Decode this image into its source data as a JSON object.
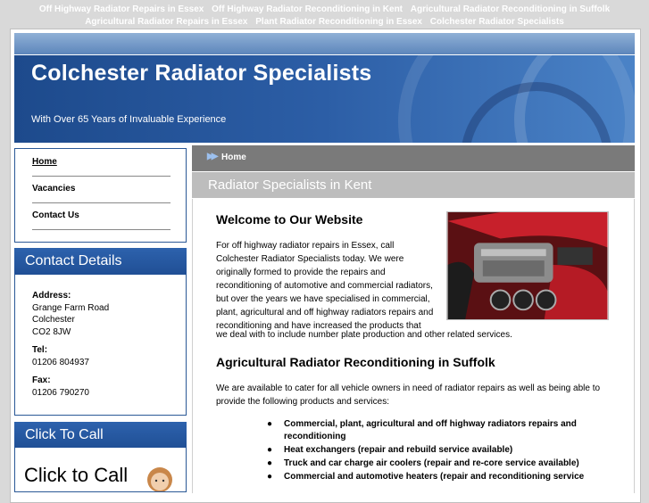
{
  "top_links": [
    "Off Highway Radiator Repairs in Essex",
    "Off Highway Radiator Reconditioning in Kent",
    "Agricultural Radiator Reconditioning in Suffolk",
    "Agricultural Radiator Repairs in Essex",
    "Plant Radiator Reconditioning in Essex",
    "Colchester Radiator Specialists"
  ],
  "header": {
    "title": "Colchester Radiator Specialists",
    "tagline": "With Over 65 Years of Invaluable Experience"
  },
  "nav": {
    "items": [
      {
        "label": "Home",
        "active": true
      },
      {
        "label": "Vacancies",
        "active": false
      },
      {
        "label": "Contact Us",
        "active": false
      }
    ]
  },
  "contact": {
    "heading": "Contact Details",
    "address_label": "Address:",
    "address_lines": [
      "Grange Farm Road",
      "Colchester",
      "CO2 8JW"
    ],
    "tel_label": "Tel:",
    "tel": "01206 804937",
    "fax_label": "Fax:",
    "fax": "01206 790270"
  },
  "click_to_call": {
    "heading": "Click To Call",
    "banner_text": "Click to Call"
  },
  "breadcrumb": {
    "label": "Home"
  },
  "page_heading": "Radiator Specialists in Kent",
  "content": {
    "welcome_title": "Welcome to Our Website",
    "intro": "For off highway radiator repairs in Essex, call Colchester Radiator Specialists today. We were originally formed to provide the repairs and reconditioning of automotive and commercial radiators, but over the years we have specialised in commercial, plant, agricultural and off highway radiators repairs and reconditioning and have increased the products that",
    "intro_tail": "we deal with to include number plate production and other related services.",
    "agri_title": "Agricultural Radiator Reconditioning in Suffolk",
    "available": "We are available to cater for all vehicle owners in need of radiator repairs as well as being able to provide the following products and services:",
    "products": [
      "Commercial, plant, agricultural and off highway radiators repairs and reconditioning",
      "Heat exchangers (repair and rebuild service available)",
      "Truck and car charge air coolers (repair and re-core service available)",
      "Commercial and automotive heaters (repair and reconditioning service"
    ]
  },
  "colors": {
    "brand_blue": "#2c5ea6",
    "page_bg": "#d9d9d9",
    "breadcrumb_bg": "#7a7a7a",
    "page_heading_bg": "#bdbdbd"
  }
}
